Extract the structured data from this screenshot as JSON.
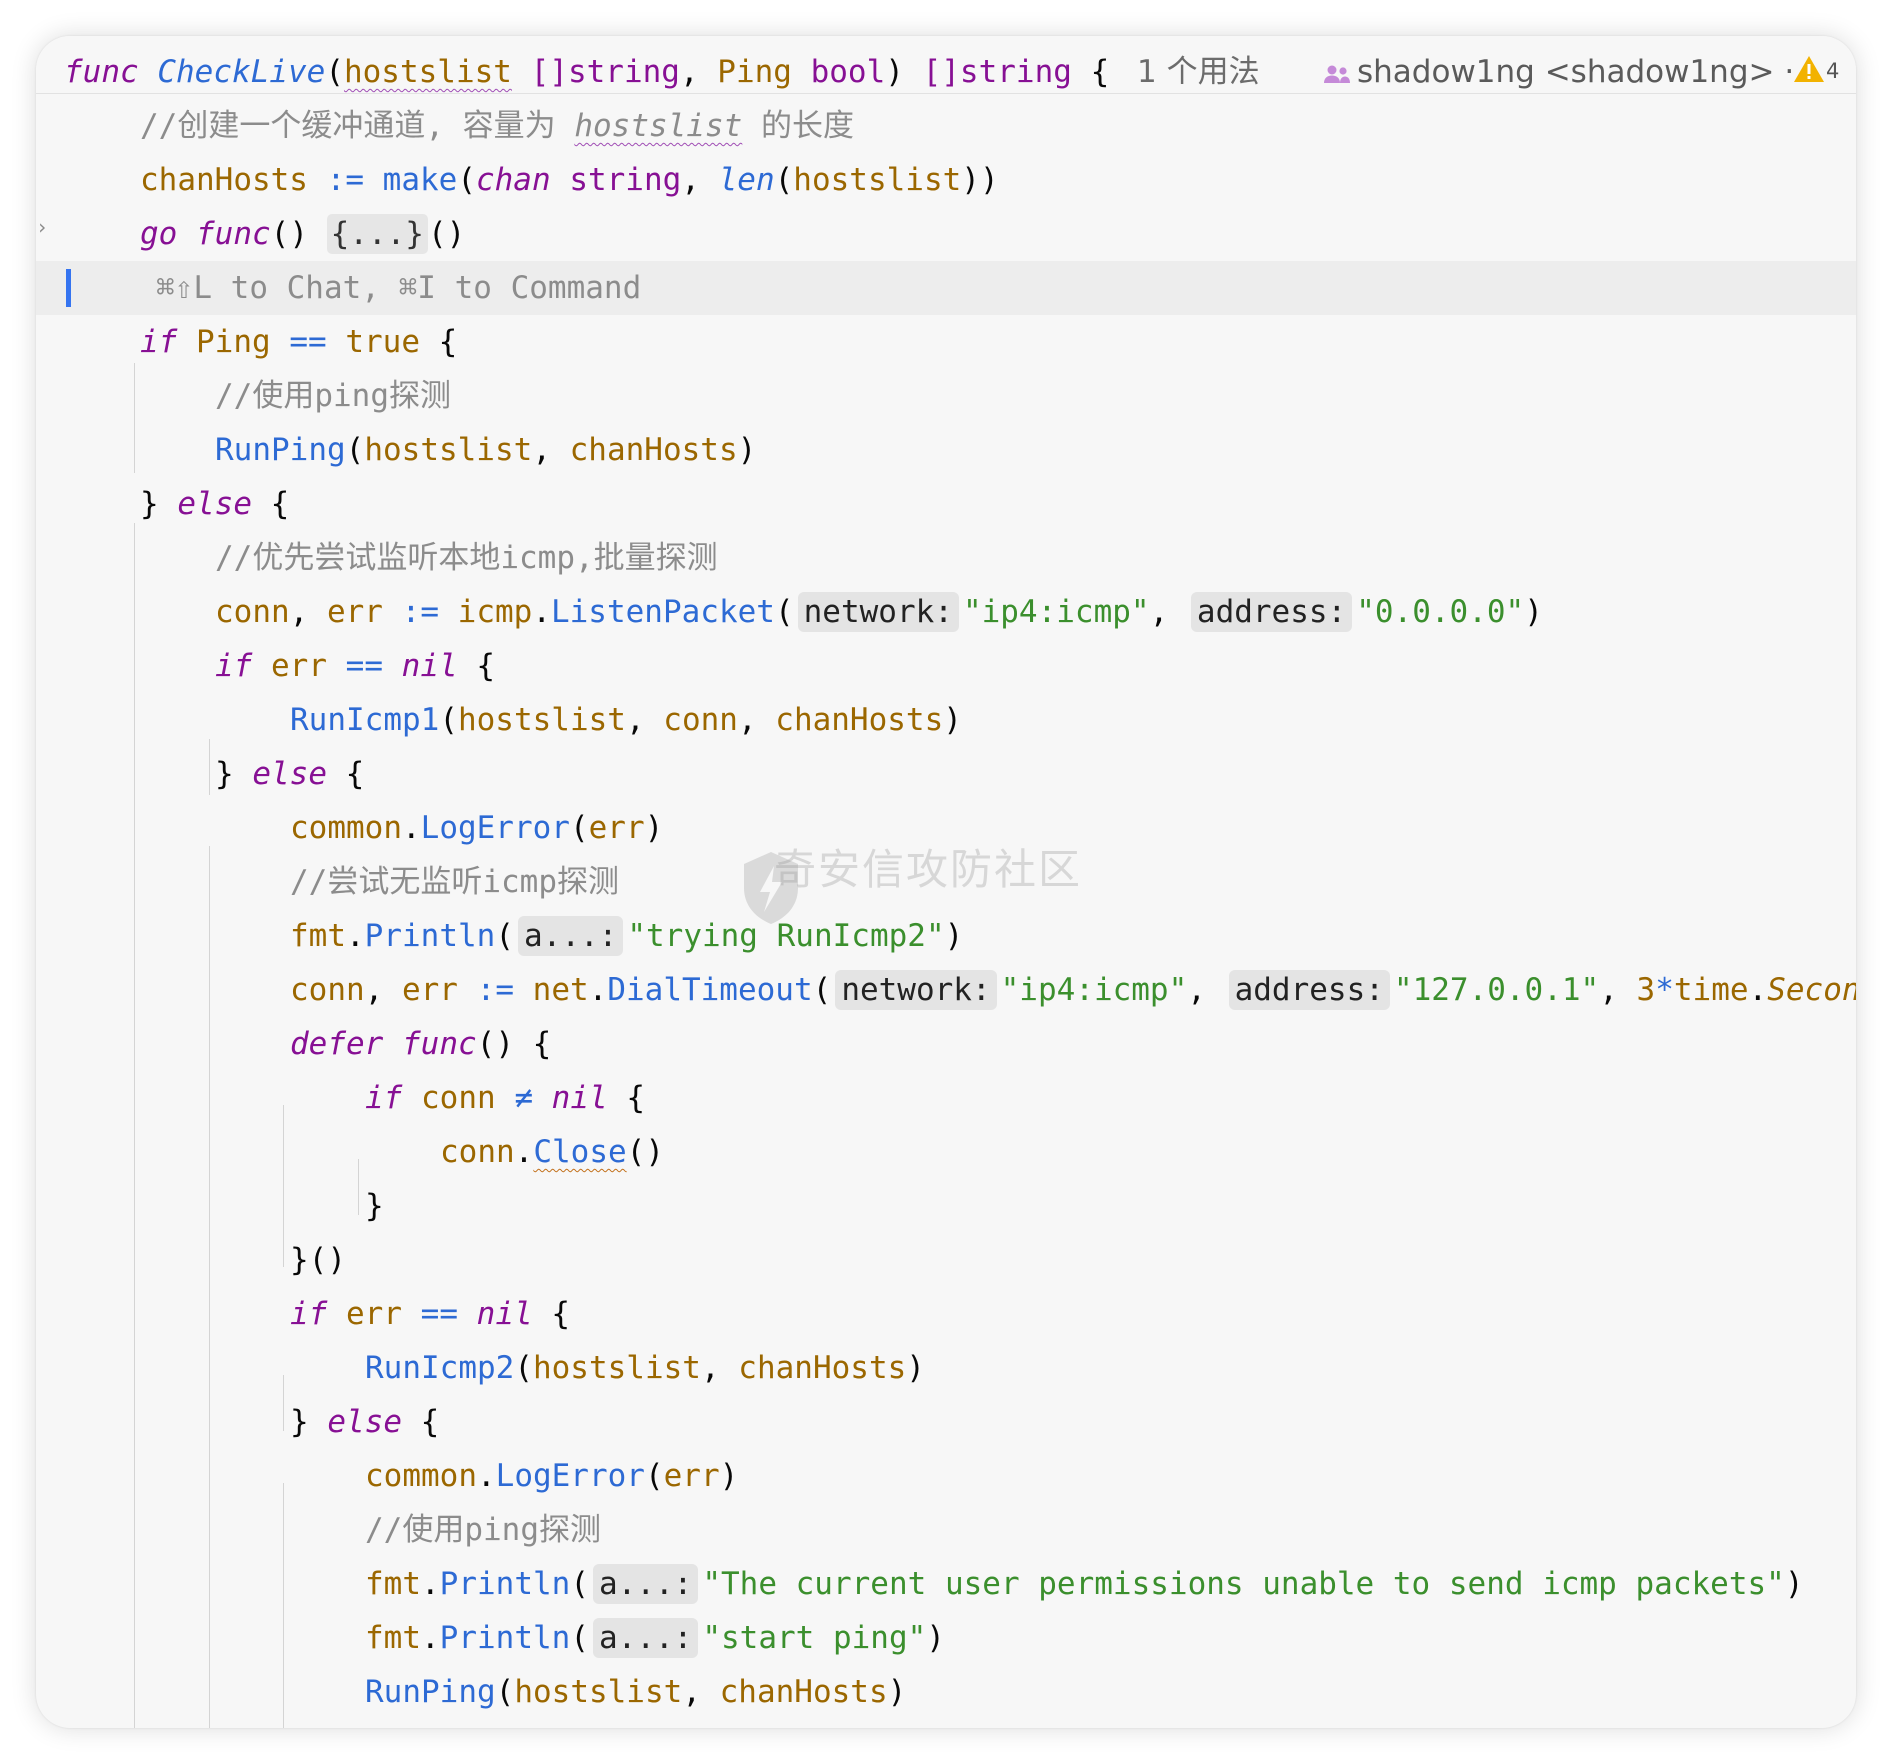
{
  "sticky_header": {
    "keyword_func": "func",
    "name": "CheckLive",
    "param1": "hostslist",
    "param1_type": "[]string",
    "param2": "Ping",
    "param2_type": "bool",
    "return_type": "[]string",
    "open_brace": "{",
    "usages": "1 个用法",
    "author": "shadow1ng <shadow1ng>",
    "author_more": "·",
    "warning_count": "4"
  },
  "inline_chat_hint": "⌘⇧L to Chat, ⌘I to Command",
  "watermark": "奇安信攻防社区",
  "code": {
    "c1": "//创建一个缓冲通道, 容量为 ",
    "c1_var": "hostslist",
    "c1_tail": " 的长度",
    "chanHosts": "chanHosts",
    "make": "make",
    "chan": "chan",
    "string": "string",
    "len": "len",
    "hostslist": "hostslist",
    "go": "go",
    "func": "func",
    "fold": "{...}",
    "if": "if",
    "Ping": "Ping",
    "true": "true",
    "c_ping": "//使用ping探测",
    "RunPing": "RunPing",
    "else": "else",
    "c_listen": "//优先尝试监听本地icmp,批量探测",
    "conn": "conn",
    "err": "err",
    "icmp": "icmp",
    "ListenPacket": "ListenPacket",
    "hint_network": "network:",
    "hint_address": "address:",
    "hint_a": "a...:",
    "s_ip4icmp": "\"ip4:icmp\"",
    "s_0000": "\"0.0.0.0\"",
    "nil": "nil",
    "RunIcmp1": "RunIcmp1",
    "common": "common",
    "LogError": "LogError",
    "c_nolisten": "//尝试无监听icmp探测",
    "fmt": "fmt",
    "Println": "Println",
    "s_trying": "\"trying RunIcmp2\"",
    "net": "net",
    "DialTimeout": "DialTimeout",
    "s_127": "\"127.0.0.1\"",
    "three": "3",
    "time": "time",
    "Second": "Secon",
    "defer": "defer",
    "Close": "Close",
    "RunIcmp2": "RunIcmp2",
    "s_perm": "\"The current user permissions unable to send icmp packets\"",
    "s_startping": "\"start ping\""
  }
}
